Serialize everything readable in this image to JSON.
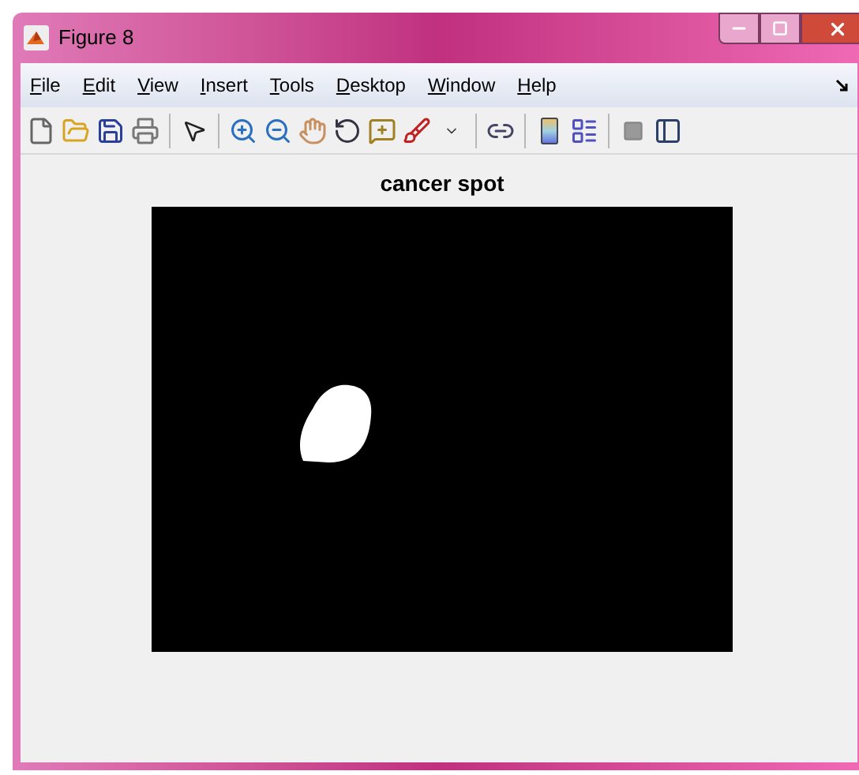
{
  "window": {
    "title": "Figure 8"
  },
  "menu": [
    {
      "label": "File"
    },
    {
      "label": "Edit"
    },
    {
      "label": "View"
    },
    {
      "label": "Insert"
    },
    {
      "label": "Tools"
    },
    {
      "label": "Desktop"
    },
    {
      "label": "Window"
    },
    {
      "label": "Help"
    }
  ],
  "axes": {
    "title": "cancer spot"
  }
}
